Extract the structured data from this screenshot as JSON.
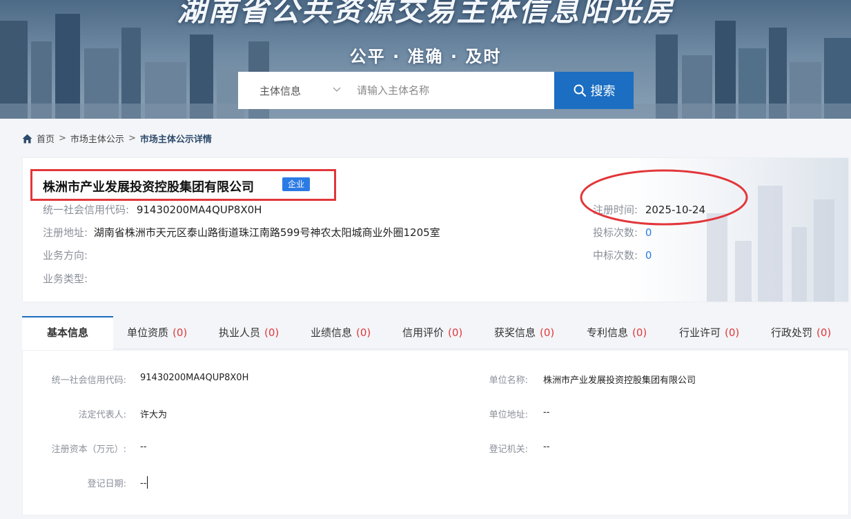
{
  "banner": {
    "title": "湖南省公共资源交易主体信息阳光房",
    "slogan": "公平 · 准确 · 及时"
  },
  "search": {
    "type_label": "主体信息",
    "placeholder": "请输入主体名称",
    "button_label": "搜索"
  },
  "breadcrumb": {
    "home": "首页",
    "section": "市场主体公示",
    "current": "市场主体公示详情",
    "separator": ">"
  },
  "entity": {
    "name": "株洲市产业发展投资控股集团有限公司",
    "type_badge": "企业",
    "credit_code_label": "统一社会信用代码:",
    "credit_code": "91430200MA4QUP8X0H",
    "address_label": "注册地址:",
    "address": "湖南省株洲市天元区泰山路街道珠江南路599号神农太阳城商业外圈1205室",
    "business_direction_label": "业务方向:",
    "business_direction": "",
    "business_type_label": "业务类型:",
    "business_type": "",
    "reg_time_label": "注册时间:",
    "reg_time": "2025-10-24",
    "bid_count_label": "投标次数:",
    "bid_count": "0",
    "win_count_label": "中标次数:",
    "win_count": "0"
  },
  "tabs": [
    {
      "label": "基本信息",
      "count": ""
    },
    {
      "label": "单位资质",
      "count": "(0)"
    },
    {
      "label": "执业人员",
      "count": "(0)"
    },
    {
      "label": "业绩信息",
      "count": "(0)"
    },
    {
      "label": "信用评价",
      "count": "(0)"
    },
    {
      "label": "获奖信息",
      "count": "(0)"
    },
    {
      "label": "专利信息",
      "count": "(0)"
    },
    {
      "label": "行业许可",
      "count": "(0)"
    },
    {
      "label": "行政处罚",
      "count": "(0)"
    }
  ],
  "details": {
    "credit_code_label": "统一社会信用代码:",
    "credit_code": "91430200MA4QUP8X0H",
    "legal_rep_label": "法定代表人:",
    "legal_rep": "许大为",
    "reg_capital_label": "注册资本（万元）:",
    "reg_capital": "--",
    "reg_date_label": "登记日期:",
    "reg_date": "--",
    "unit_name_label": "单位名称:",
    "unit_name": "株洲市产业发展投资控股集团有限公司",
    "unit_address_label": "单位地址:",
    "unit_address": "--",
    "reg_authority_label": "登记机关:",
    "reg_authority": "--"
  },
  "colors": {
    "accent": "#1b6ec2",
    "badge": "#2c7be5",
    "highlight": "#e2363a",
    "count": "#e2363a"
  },
  "icons": [
    "home-icon",
    "chevron-down-icon",
    "search-icon"
  ]
}
